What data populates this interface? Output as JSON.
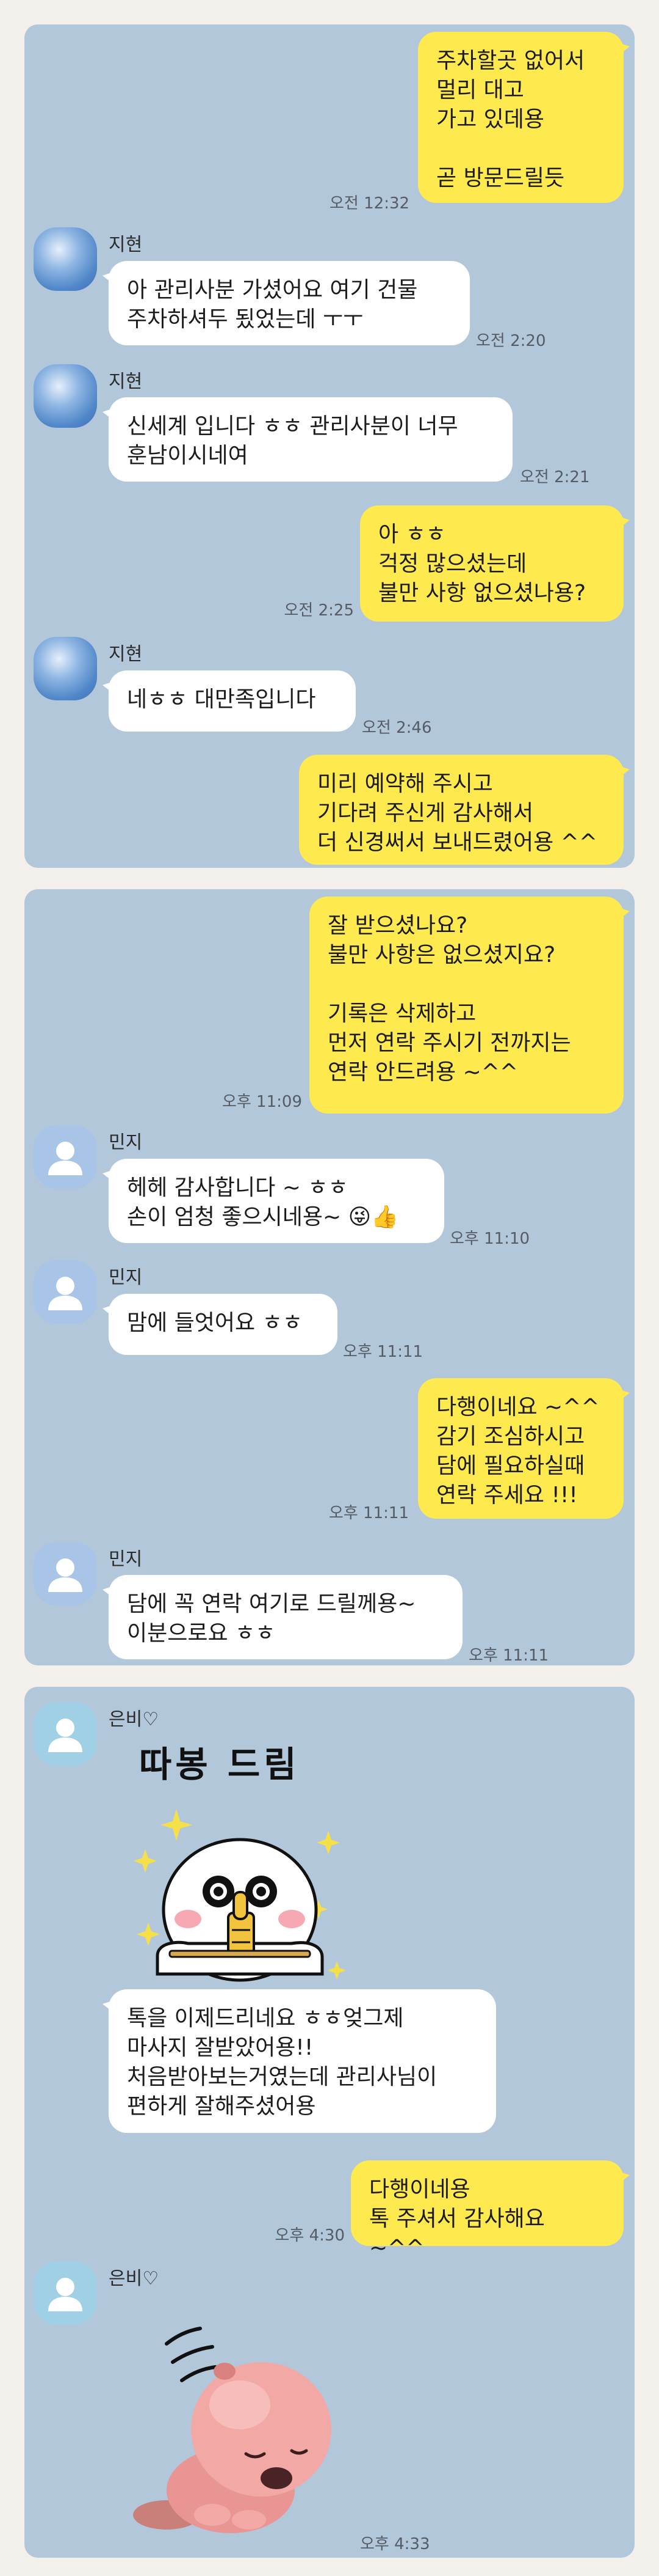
{
  "panel1": {
    "messages": [
      {
        "text": "주차할곳 없어서\n멀리 대고\n가고 있데용\n\n곧 방문드릴듯",
        "time": "오전 12:32"
      },
      {
        "sender": "지현",
        "text": "아 관리사분 가셨어요 여기 건물\n주차하셔두 됬었는데 ㅜㅜ",
        "time": "오전 2:20"
      },
      {
        "sender": "지현",
        "text": "신세계 입니다 ㅎㅎ 관리사분이 너무\n훈남이시네여",
        "time": "오전 2:21"
      },
      {
        "text": "아 ㅎㅎ\n걱정 많으셨는데\n불만 사항 없으셨나용?",
        "time": "오전 2:25"
      },
      {
        "sender": "지현",
        "text": "네ㅎㅎ 대만족입니다",
        "time": "오전 2:46"
      },
      {
        "text": "미리 예약해 주시고\n기다려 주신게 감사해서\n더 신경써서 보내드렸어용 ^^",
        "time": ""
      }
    ]
  },
  "panel2": {
    "messages": [
      {
        "text": "잘 받으셨나요?\n불만 사항은 없으셨지요?\n\n기록은 삭제하고\n먼저 연락 주시기 전까지는\n연락 안드려용 ~^^",
        "time": "오후 11:09"
      },
      {
        "sender": "민지",
        "text": "헤헤 감사합니다 ~ ㅎㅎ\n손이 엄청 좋으시네용~ 😜👍",
        "time": "오후 11:10"
      },
      {
        "sender": "민지",
        "text": "맘에 들엇어요 ㅎㅎ",
        "time": "오후 11:11"
      },
      {
        "text": "다행이네요 ~^^\n감기 조심하시고\n담에 필요하실때\n연락 주세요 !!!",
        "time": "오후 11:11"
      },
      {
        "sender": "민지",
        "text": "담에 꼭 연락 여기로 드릴께용~\n이분으로요 ㅎㅎ",
        "time": "오후 11:11"
      }
    ]
  },
  "panel3": {
    "messages": [
      {
        "sender": "은비♡",
        "sticker_text": "따봉 드림",
        "sticker_icon": "thumbs-up-character-sticker"
      },
      {
        "text": "톡을 이제드리네요 ㅎㅎ엊그제\n마사지 잘받았어용!!\n처음받아보는거였는데 관리사님이\n편하게 잘해주셨어용"
      },
      {
        "text": "다행이네용\n톡 주셔서 감사해요 ~^^",
        "time": "오후 4:30"
      },
      {
        "sender": "은비♡",
        "sticker_icon": "pink-beaver-bowing-sticker",
        "time": "오후 4:33"
      }
    ]
  },
  "colors": {
    "chat_background": "#b2c7da",
    "outgoing_bubble": "#fee94f",
    "incoming_bubble": "#ffffff",
    "page_background": "#f3f0eb"
  }
}
